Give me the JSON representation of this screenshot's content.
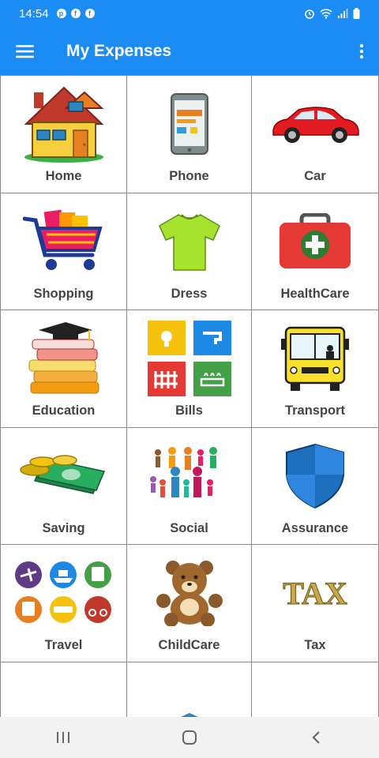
{
  "status": {
    "time": "14:54",
    "left_icons": [
      "pinterest-icon",
      "facebook-icon",
      "facebook-icon"
    ],
    "right_icons": [
      "alarm-icon",
      "wifi-icon",
      "signal-icon",
      "battery-icon"
    ]
  },
  "app_bar": {
    "title": "My Expenses",
    "menu_icon": "hamburger-menu-icon",
    "more_icon": "overflow-menu-icon",
    "color": "#1a8cf3"
  },
  "categories": [
    {
      "label": "Home",
      "icon": "house-icon"
    },
    {
      "label": "Phone",
      "icon": "smartphone-icon"
    },
    {
      "label": "Car",
      "icon": "car-icon"
    },
    {
      "label": "Shopping",
      "icon": "shopping-cart-icon"
    },
    {
      "label": "Dress",
      "icon": "t-shirt-icon"
    },
    {
      "label": "HealthCare",
      "icon": "first-aid-kit-icon"
    },
    {
      "label": "Education",
      "icon": "books-graduation-cap-icon"
    },
    {
      "label": "Bills",
      "icon": "utility-bills-icon"
    },
    {
      "label": "Transport",
      "icon": "bus-icon"
    },
    {
      "label": "Saving",
      "icon": "money-coins-icon"
    },
    {
      "label": "Social",
      "icon": "people-icon"
    },
    {
      "label": "Assurance",
      "icon": "shield-icon"
    },
    {
      "label": "Travel",
      "icon": "travel-modes-icon"
    },
    {
      "label": "ChildCare",
      "icon": "teddy-bear-icon"
    },
    {
      "label": "Tax",
      "icon": "tax-text-icon"
    },
    {
      "label": "",
      "icon": "burger-icon"
    },
    {
      "label": "",
      "icon": "bank-building-icon"
    },
    {
      "label": "",
      "icon": "pets-icon"
    }
  ],
  "nav_bar": {
    "recents_icon": "recents-icon",
    "home_icon": "home-circle-icon",
    "back_icon": "back-chevron-icon"
  }
}
